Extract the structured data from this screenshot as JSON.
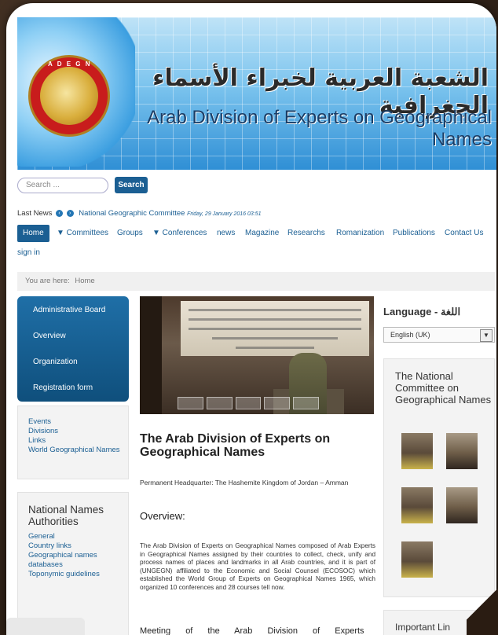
{
  "banner": {
    "logo_ring": "A D E G N",
    "arabic_title": "الشعبة العربية لخبراء الأسماء الجغرافية",
    "english_title": "Arab Division of Experts on Geographical Names"
  },
  "search": {
    "placeholder": "Search ...",
    "button_label": "Search"
  },
  "last_news": {
    "label": "Last News",
    "prev_icon": "‹",
    "next_icon": "›",
    "headline": "National Geographic Committee",
    "date": "Friday, 29 January 2016 03:51"
  },
  "menu": {
    "items": [
      "Home",
      "▼ Committees",
      "Groups",
      "▼ Conferences",
      "news",
      "Magazine",
      "Researchs",
      "Romanization",
      "Publications",
      "Contact Us"
    ],
    "signin": "sign in"
  },
  "breadcrumb": {
    "prefix": "You are here:",
    "current": "Home"
  },
  "sidebar": {
    "nav": [
      "Administrative Board",
      "Overview",
      "Organization",
      "Registration form"
    ],
    "links": [
      "Events",
      "Divisions",
      "Links",
      "World Geographical Names"
    ]
  },
  "nna": {
    "title": "National Names Authorities",
    "links": [
      "General",
      "Country links",
      "Geographical names",
      "databases",
      "Toponymic guidelines"
    ]
  },
  "article": {
    "title": "The Arab Division of Experts on Geographical Names",
    "headquarter": "Permanent Headquarter: The Hashemite Kingdom of Jordan – Amman",
    "overview_title": "Overview:",
    "overview_text": "The Arab Division of Experts on Geographical Names composed of Arab Experts in Geographical Names assigned by their countries to collect, check, unify and process names of places and landmarks in all Arab countries, and it is part of (UNGEGN) affiliated to the Economic and Social Counsel (ECOSOC) which established the World Group of Experts on Geographical Names 1965, which organized 10 conferences and 28 courses tell now.",
    "meeting": "Meeting of the Arab Division of Experts on"
  },
  "language": {
    "title": "Language - اللغة",
    "selected": "English (UK)",
    "caret": "▼"
  },
  "committee": {
    "title": "The National Committee on Geographical Names"
  },
  "important": {
    "title": "Important Lin"
  }
}
